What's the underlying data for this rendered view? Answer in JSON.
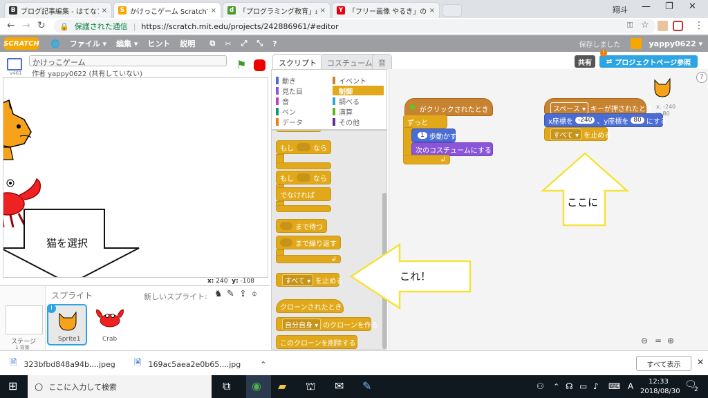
{
  "browser": {
    "tabs": [
      {
        "label": "ブログ記事編集 - はてなブログ",
        "color": "#333333",
        "glyph": "B"
      },
      {
        "label": "かけっこゲーム Scratchで作成",
        "color": "#f6a700",
        "glyph": "S"
      },
      {
        "label": "「プログラミング教育」必修化",
        "color": "#4a9c2f",
        "glyph": "d"
      },
      {
        "label": "「フリー画像 やるき」の検索結果",
        "color": "#e60012",
        "glyph": "Y"
      }
    ],
    "user_name": "翔斗",
    "secure_label": "保護された通信",
    "url": "https://scratch.mit.edu/projects/242886961/#editor"
  },
  "menu": {
    "logo": "SCRATCH",
    "items": [
      "ファイル ▾",
      "編集 ▾",
      "ヒント",
      "説明"
    ],
    "saved_label": "保存しました",
    "username": "yappy0622 ▾"
  },
  "project": {
    "title": "かけっこゲーム",
    "author": "作者 yappy0622 (共有していない)",
    "version": "v461"
  },
  "stage": {
    "x_label": "x:",
    "x_value": "240",
    "y_label": "y:",
    "y_value": "-108"
  },
  "sprites": {
    "header": "スプライト",
    "new_sprite": "新しいスプライト:",
    "stage_label": "ステージ",
    "stage_sub": "1 背景",
    "items": [
      "Sprite1",
      "Crab"
    ]
  },
  "palette": {
    "tabs": [
      "スクリプト",
      "コスチューム",
      "音"
    ],
    "categories_left": [
      {
        "label": "動き",
        "color": "#4a6cd4"
      },
      {
        "label": "見た目",
        "color": "#8a55d7"
      },
      {
        "label": "音",
        "color": "#bb42c3"
      },
      {
        "label": "ペン",
        "color": "#0e9a6c"
      },
      {
        "label": "データ",
        "color": "#ee7d16"
      }
    ],
    "categories_right": [
      {
        "label": "イベント",
        "color": "#c88330"
      },
      {
        "label": "制御",
        "color": "#e1a91a"
      },
      {
        "label": "調べる",
        "color": "#2ca5e2"
      },
      {
        "label": "演算",
        "color": "#5cb712"
      },
      {
        "label": "その他",
        "color": "#632d99"
      }
    ],
    "blocks": {
      "if_then": "もし",
      "then": "なら",
      "else": "でなければ",
      "wait_until": "まで待つ",
      "repeat_until": "まで繰り返す",
      "stop_option": "すべて ▾",
      "stop_suffix": "を止める",
      "clone_start": "クローンされたとき",
      "clone_self": "自分自身 ▾",
      "clone_create": "のクローンを作る",
      "clone_delete": "このクローンを削除する"
    }
  },
  "scripts": {
    "share": "共有",
    "project_page": "プロジェクトページ参照",
    "script1": {
      "hat": "がクリックされたとき",
      "forever": "ずっと",
      "move_value": "1",
      "move_label": "歩動かす",
      "next_costume": "次のコスチュームにする"
    },
    "script2": {
      "key_option": "スペース ▾",
      "key_label": "キーが押されたとき",
      "goto_x_label": "x座標を",
      "goto_x": "-240",
      "goto_y_label": "、y座標を",
      "goto_y": "80",
      "goto_suffix": "にする",
      "stop_option": "すべて ▾",
      "stop_suffix": "を止める"
    },
    "sprite_x": "x: -240",
    "sprite_y": "y: 80"
  },
  "callouts": {
    "select_cat": "猫を選択",
    "here": "ここに",
    "this": "これ！"
  },
  "downloads": {
    "items": [
      "323bfbd848a94b....jpeg",
      "169ac5aea2e0b65....jpg"
    ],
    "show_all": "すべて表示"
  },
  "taskbar": {
    "search_placeholder": "ここに入力して検索",
    "time": "12:33",
    "date": "2018/08/30",
    "notification_count": "2"
  }
}
